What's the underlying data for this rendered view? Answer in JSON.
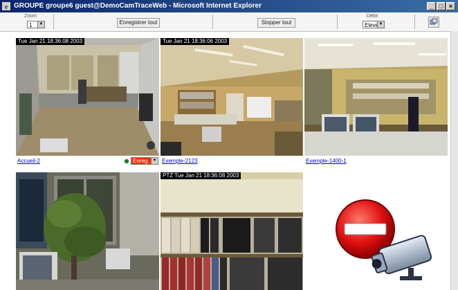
{
  "window": {
    "title": "GROUPE groupe6   guest@DemoCamTraceWeb - Microsoft Internet Explorer"
  },
  "toolbar": {
    "zoom_label": "Zoom",
    "zoom_value": "1",
    "record_all_label": "Enregistrer tout",
    "stop_all_label": "Stopper tout",
    "rate_label": "Débit",
    "rate_value": "Elevé"
  },
  "cameras": [
    {
      "name": "Accueil-2",
      "timestamp": "Tue Jan 21  18:36:08  2003",
      "record_mode": "Enreg."
    },
    {
      "name": "Exemple-2123",
      "timestamp": "Tue Jan 21  18:36:06  2003"
    },
    {
      "name": "Exemple-1400-1",
      "timestamp": ""
    },
    {
      "name": "",
      "timestamp": ""
    },
    {
      "name": "",
      "timestamp": "PTZ  Tue Jan 21  18:36:08  2003"
    },
    {
      "name": "",
      "timestamp": "",
      "status": "unavailable"
    }
  ],
  "colors": {
    "titlebar": "#0a246a",
    "link": "#0000cc",
    "record_active": "#ff2a00",
    "status_ok": "#1a8a2a",
    "no_signal_red": "#d40000"
  },
  "icons": [
    "ie-logo-icon",
    "minimize-icon",
    "maximize-icon",
    "close-icon",
    "fullscreen-icon",
    "camera-unavailable-icon"
  ]
}
